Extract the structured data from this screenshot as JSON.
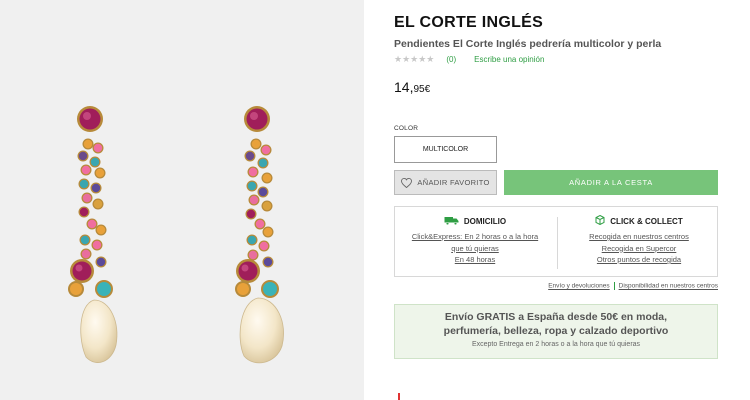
{
  "product": {
    "brand": "EL CORTE INGLÉS",
    "name": "Pendientes El Corte Inglés pedrería multicolor y perla",
    "stars": "★★★★★",
    "rating_count": "(0)",
    "write_review": "Escribe una opinión",
    "price_whole": "14,",
    "price_cents": "95€",
    "image_alt": "Pendientes pedrería multicolor y perla"
  },
  "color": {
    "label": "COLOR",
    "selected": "MULTICOLOR"
  },
  "actions": {
    "favorite": "AÑADIR FAVORITO",
    "add_to_cart": "AÑADIR A LA CESTA"
  },
  "delivery": {
    "home": {
      "title": "DOMICILIO",
      "links": [
        "Click&Express: En 2 horas o a la hora",
        "que tú quieras",
        "En 48 horas"
      ]
    },
    "collect": {
      "title": "CLICK & COLLECT",
      "links": [
        "Recogida en nuestros centros",
        "Recogida en Supercor",
        "Otros puntos de recogida"
      ]
    }
  },
  "info_links": {
    "shipping": "Envío y devoluciones",
    "availability": "Disponibilidad en nuestros centros"
  },
  "promo": {
    "main": "Envío GRATIS a España desde 50€ en moda, perfumería, belleza, ropa y calzado deportivo",
    "sub": "Excepto Entrega en 2 horas o a la hora que tú quieras"
  },
  "colors": {
    "green": "#77c47a",
    "link_green": "#2f9e44",
    "promo_bg": "#eef5ea",
    "gallery_bg": "#f0f0f0"
  }
}
